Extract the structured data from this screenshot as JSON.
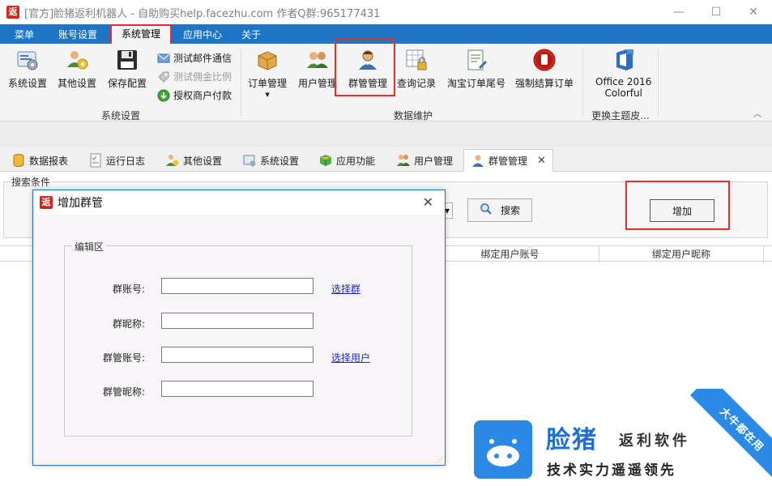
{
  "window": {
    "app_icon": "返",
    "title": "[官方]脸猪返利机器人 - 自助购买help.facezhu.com 作者Q群:965177431",
    "minimize": "—",
    "maximize": "☐",
    "close": "✕"
  },
  "menu": {
    "items": [
      "菜单",
      "账号设置",
      "系统管理",
      "应用中心",
      "关于"
    ],
    "active": "系统管理"
  },
  "ribbon": {
    "system_settings_group": {
      "label": "系统设置",
      "buttons": [
        "系统设置",
        "其他设置",
        "保存配置"
      ],
      "small_buttons": [
        {
          "label": "测试邮件通信",
          "enabled": true
        },
        {
          "label": "测试佣金比例",
          "enabled": false
        },
        {
          "label": "授权商户付款",
          "enabled": true
        }
      ]
    },
    "data_group": {
      "label": "数据维护",
      "buttons": [
        "订单管理",
        "用户管理",
        "群管管理",
        "查询记录",
        "淘宝订单尾号",
        "强制结算订单"
      ]
    },
    "theme_group": {
      "label": "更换主题皮...",
      "button_line1": "Office 2016",
      "button_line2": "Colorful"
    }
  },
  "tabs": [
    {
      "label": "数据报表",
      "active": false
    },
    {
      "label": "运行日志",
      "active": false
    },
    {
      "label": "其他设置",
      "active": false
    },
    {
      "label": "系统设置",
      "active": false
    },
    {
      "label": "应用功能",
      "active": false
    },
    {
      "label": "用户管理",
      "active": false
    },
    {
      "label": "群管管理",
      "active": true
    }
  ],
  "search": {
    "legend": "搜索条件",
    "search_label": "搜索",
    "add_label": "增加"
  },
  "grid": {
    "columns": [
      "绑定用户账号",
      "绑定用户昵称"
    ]
  },
  "dialog": {
    "title": "增加群管",
    "fieldset_legend": "编辑区",
    "fields": [
      {
        "label": "群账号:",
        "value": "",
        "link": "选择群"
      },
      {
        "label": "群昵称:",
        "value": "",
        "link": ""
      },
      {
        "label": "群管账号:",
        "value": "",
        "link": "选择用户"
      },
      {
        "label": "群管昵称:",
        "value": "",
        "link": ""
      }
    ]
  },
  "watermark": {
    "brand": "脸猪",
    "line1": "返利软件",
    "line2": "技术实力遥遥领先",
    "ribbon": "大牛都在用"
  },
  "colors": {
    "menubar": "#1f74c6",
    "highlight": "#e0312e",
    "link": "#1a2ac9",
    "brand_blue": "#2a8ae6"
  }
}
